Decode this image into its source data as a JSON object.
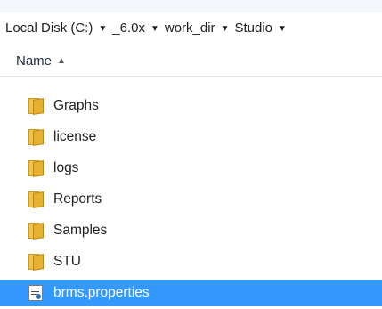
{
  "breadcrumb": {
    "items": [
      "Local Disk (C:)",
      "_6.0x",
      "work_dir",
      "Studio"
    ]
  },
  "header": {
    "name_column": "Name"
  },
  "files": [
    {
      "name": "Graphs",
      "type": "folder",
      "selected": false
    },
    {
      "name": "license",
      "type": "folder",
      "selected": false
    },
    {
      "name": "logs",
      "type": "folder",
      "selected": false
    },
    {
      "name": "Reports",
      "type": "folder",
      "selected": false
    },
    {
      "name": "Samples",
      "type": "folder",
      "selected": false
    },
    {
      "name": "STU",
      "type": "folder",
      "selected": false
    },
    {
      "name": "brms.properties",
      "type": "properties-file",
      "selected": true
    }
  ],
  "colors": {
    "selection": "#3399ff",
    "folder": "#e8b030"
  }
}
